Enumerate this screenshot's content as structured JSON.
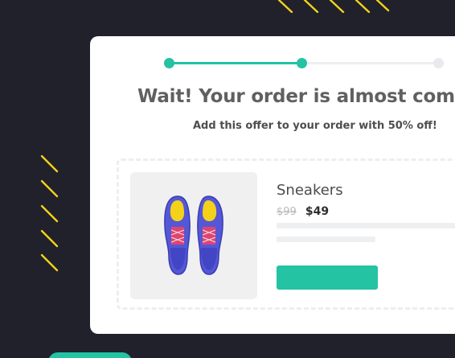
{
  "colors": {
    "background": "#20212b",
    "card": "#ffffff",
    "accent": "#23c3a4",
    "stripes": "#f2d21b"
  },
  "progress": {
    "current_step": 2,
    "total_steps": 3,
    "fill_fraction": 0.5
  },
  "offer": {
    "headline": "Wait! Your order is almost complete",
    "subline": "Add this offer to your order with 50% off!"
  },
  "product": {
    "image_icon": "sneakers-icon",
    "name": "Sneakers",
    "price_original": "$99",
    "price_discounted": "$49",
    "add_button_label": ""
  }
}
